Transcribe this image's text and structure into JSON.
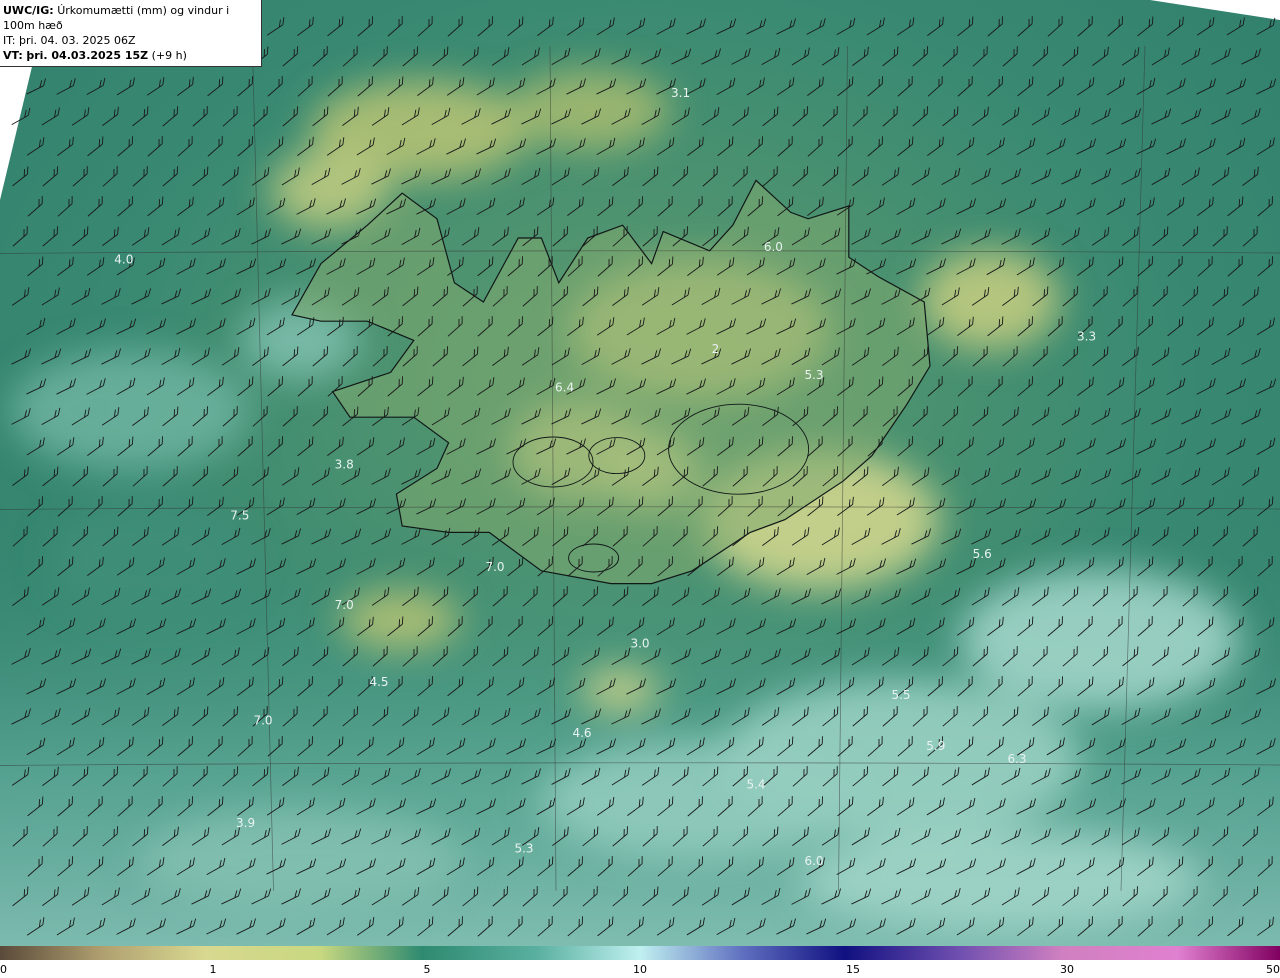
{
  "header": {
    "model": "UWC/IG:",
    "title": "Úrkomumætti (mm) og vindur i 100m hæð",
    "it_line": "IT: þri. 04. 03. 2025 06Z",
    "vt_label": "VT:",
    "vt_value": "þri. 04.03.2025 15Z",
    "vt_offset": "(+9 h)"
  },
  "map_labels": [
    {
      "text": "3.1",
      "lon": -17.8,
      "lat": 67.2
    },
    {
      "text": "4.0",
      "lon": -27.4,
      "lat": 65.9
    },
    {
      "text": "6.0",
      "lon": -16.2,
      "lat": 66.0
    },
    {
      "text": "3.3",
      "lon": -10.8,
      "lat": 65.3
    },
    {
      "text": "2",
      "lon": -17.2,
      "lat": 65.2
    },
    {
      "text": "5.3",
      "lon": -15.5,
      "lat": 65.0
    },
    {
      "text": "6.4",
      "lon": -19.8,
      "lat": 64.9
    },
    {
      "text": "3.8",
      "lon": -23.6,
      "lat": 64.3
    },
    {
      "text": "7.5",
      "lon": -25.4,
      "lat": 63.9
    },
    {
      "text": "7.0",
      "lon": -21.0,
      "lat": 63.5
    },
    {
      "text": "5.6",
      "lon": -12.6,
      "lat": 63.6
    },
    {
      "text": "7.0",
      "lon": -23.6,
      "lat": 63.2
    },
    {
      "text": "3.0",
      "lon": -18.5,
      "lat": 62.9
    },
    {
      "text": "4.5",
      "lon": -23.0,
      "lat": 62.6
    },
    {
      "text": "5.5",
      "lon": -14.0,
      "lat": 62.5
    },
    {
      "text": "7.0",
      "lon": -25.0,
      "lat": 62.3
    },
    {
      "text": "4.6",
      "lon": -19.5,
      "lat": 62.2
    },
    {
      "text": "5.9",
      "lon": -13.4,
      "lat": 62.1
    },
    {
      "text": "6.3",
      "lon": -12.0,
      "lat": 62.0
    },
    {
      "text": "5.4",
      "lon": -16.5,
      "lat": 61.8
    },
    {
      "text": "3.9",
      "lon": -25.3,
      "lat": 61.5
    },
    {
      "text": "5.3",
      "lon": -20.5,
      "lat": 61.3
    },
    {
      "text": "6.0",
      "lon": -15.5,
      "lat": 61.2
    }
  ],
  "colorbar": {
    "ticks": [
      "0",
      "1",
      "5",
      "10",
      "15",
      "30",
      "50"
    ],
    "stops": [
      {
        "v": 0.0,
        "c": "#5a4a3a"
      },
      {
        "v": 0.08,
        "c": "#b0a070"
      },
      {
        "v": 0.16,
        "c": "#d8d890"
      },
      {
        "v": 0.25,
        "c": "#c8d880"
      },
      {
        "v": 0.33,
        "c": "#2e8a70"
      },
      {
        "v": 0.42,
        "c": "#5ab0a0"
      },
      {
        "v": 0.5,
        "c": "#c0f0f0"
      },
      {
        "v": 0.58,
        "c": "#6070c0"
      },
      {
        "v": 0.66,
        "c": "#101080"
      },
      {
        "v": 0.75,
        "c": "#7050b0"
      },
      {
        "v": 0.83,
        "c": "#d080c0"
      },
      {
        "v": 0.92,
        "c": "#e080d0"
      },
      {
        "v": 1.0,
        "c": "#800060"
      }
    ]
  },
  "colors": {
    "land_fill": "#8aa86a",
    "sea_fill": "#2f8a78",
    "coast": "#101818",
    "grid": "#333",
    "barb": "#1a1a1a",
    "label": "#e8f2f0"
  }
}
